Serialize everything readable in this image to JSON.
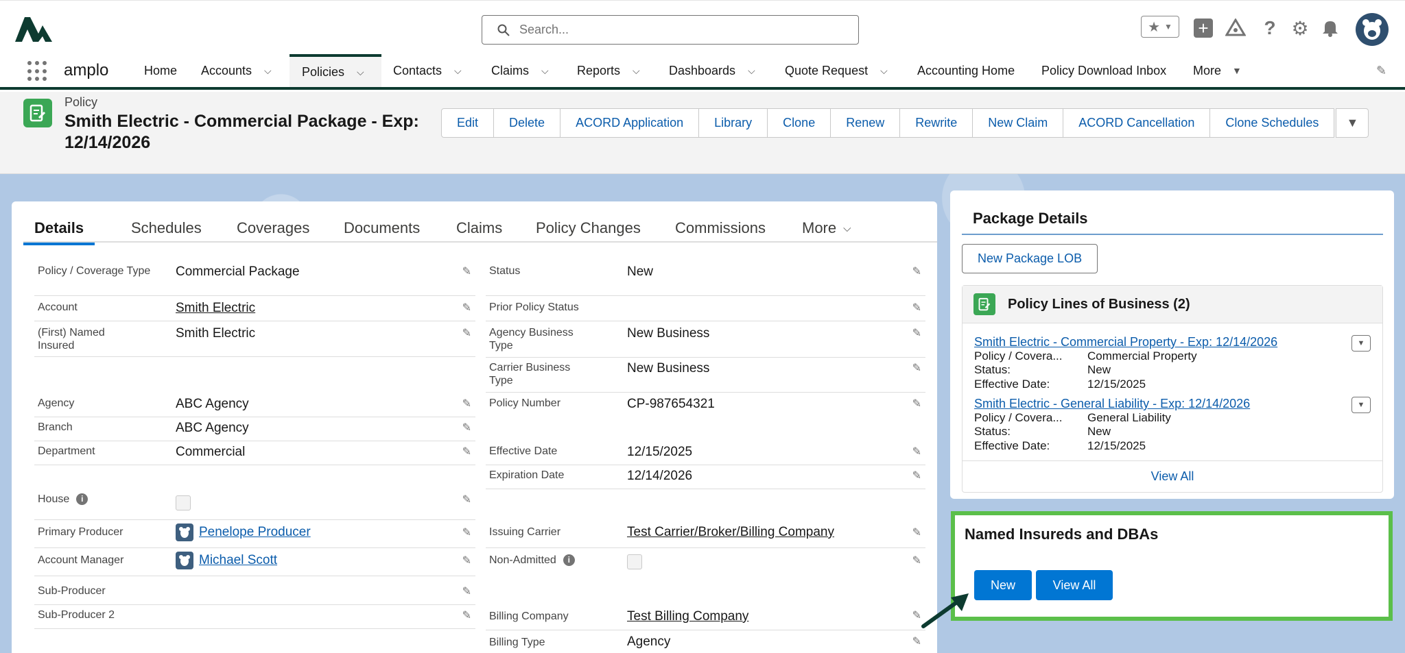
{
  "search": {
    "placeholder": "Search..."
  },
  "nav": {
    "app_name": "amplo",
    "items": [
      {
        "label": "Home"
      },
      {
        "label": "Accounts"
      },
      {
        "label": "Policies"
      },
      {
        "label": "Contacts"
      },
      {
        "label": "Claims"
      },
      {
        "label": "Reports"
      },
      {
        "label": "Dashboards"
      },
      {
        "label": "Quote Request"
      },
      {
        "label": "Accounting Home"
      },
      {
        "label": "Policy Download Inbox"
      },
      {
        "label": "More"
      }
    ]
  },
  "record": {
    "type": "Policy",
    "title": "Smith Electric - Commercial Package - Exp: 12/14/2026",
    "actions": [
      "Edit",
      "Delete",
      "ACORD Application",
      "Library",
      "Clone",
      "Renew",
      "Rewrite",
      "New Claim",
      "ACORD Cancellation",
      "Clone Schedules"
    ]
  },
  "tabs": [
    "Details",
    "Schedules",
    "Coverages",
    "Documents",
    "Claims",
    "Policy Changes",
    "Commissions",
    "More"
  ],
  "left_fields": {
    "policy_type": {
      "label": "Policy / Coverage Type",
      "value": "Commercial Package"
    },
    "account": {
      "label": "Account",
      "value": "Smith Electric"
    },
    "named_insured": {
      "label": "(First) Named Insured",
      "value": "Smith Electric"
    },
    "agency": {
      "label": "Agency",
      "value": "ABC Agency"
    },
    "branch": {
      "label": "Branch",
      "value": "ABC Agency"
    },
    "department": {
      "label": "Department",
      "value": "Commercial"
    },
    "house": {
      "label": "House"
    },
    "primary_producer": {
      "label": "Primary Producer",
      "value": "Penelope Producer"
    },
    "account_manager": {
      "label": "Account Manager",
      "value": "Michael Scott"
    },
    "sub_producer": {
      "label": "Sub-Producer"
    },
    "sub_producer_2": {
      "label": "Sub-Producer 2"
    }
  },
  "right_fields": {
    "status": {
      "label": "Status",
      "value": "New"
    },
    "prior_status": {
      "label": "Prior Policy Status"
    },
    "agency_business_type": {
      "label": "Agency Business Type",
      "value": "New Business"
    },
    "carrier_business_type": {
      "label": "Carrier Business Type",
      "value": "New Business"
    },
    "policy_number": {
      "label": "Policy Number",
      "value": "CP-987654321"
    },
    "effective_date": {
      "label": "Effective Date",
      "value": "12/15/2025"
    },
    "expiration_date": {
      "label": "Expiration Date",
      "value": "12/14/2026"
    },
    "issuing_carrier": {
      "label": "Issuing Carrier",
      "value": "Test Carrier/Broker/Billing Company"
    },
    "non_admitted": {
      "label": "Non-Admitted"
    },
    "billing_company": {
      "label": "Billing Company",
      "value": "Test Billing Company"
    },
    "billing_type": {
      "label": "Billing Type",
      "value": "Agency"
    }
  },
  "package": {
    "title": "Package Details",
    "new_lob": "New Package LOB",
    "lob_title": "Policy Lines of Business (2)",
    "lobs": [
      {
        "name": "Smith Electric - Commercial Property - Exp: 12/14/2026",
        "type_label": "Policy / Covera...",
        "type": "Commercial Property",
        "status_label": "Status:",
        "status": "New",
        "eff_label": "Effective Date:",
        "eff": "12/15/2025"
      },
      {
        "name": "Smith Electric - General Liability - Exp: 12/14/2026",
        "type_label": "Policy / Covera...",
        "type": "General Liability",
        "status_label": "Status:",
        "status": "New",
        "eff_label": "Effective Date:",
        "eff": "12/15/2025"
      }
    ],
    "view_all": "View All"
  },
  "named": {
    "title": "Named Insureds and DBAs",
    "new": "New",
    "view_all": "View All"
  },
  "colors": {
    "brand": "#0176d3",
    "nav_border": "#0d3b30",
    "policy_icon": "#3ba755",
    "highlight": "#5bbf4a"
  }
}
